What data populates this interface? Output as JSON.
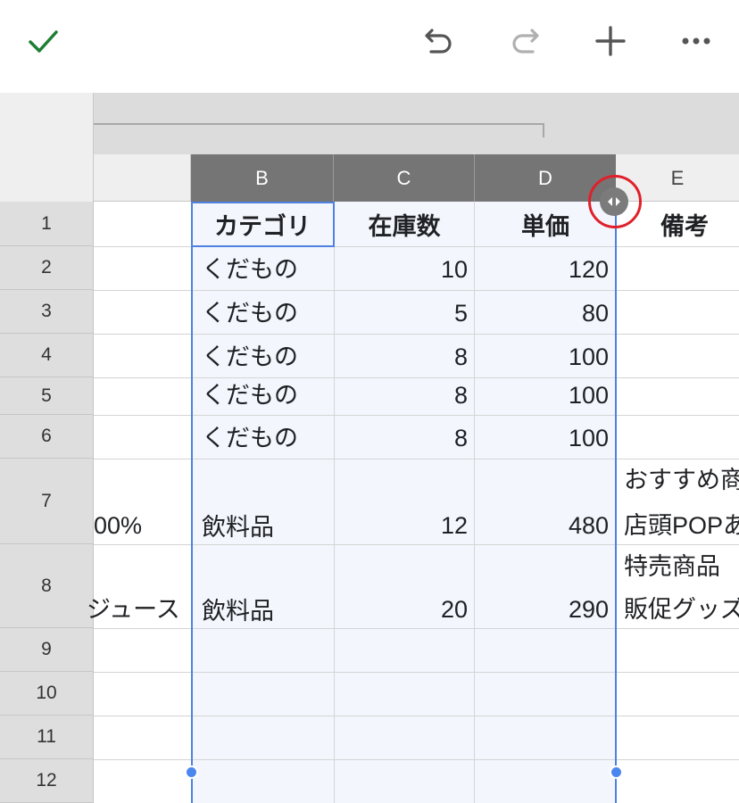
{
  "toolbar": {
    "done_icon": "check-icon",
    "undo_icon": "undo-icon",
    "redo_icon": "redo-icon",
    "add_icon": "plus-icon",
    "more_icon": "more-horizontal-icon",
    "done_color": "#1e7e34",
    "redo_disabled_color": "#b0b0b0"
  },
  "columns": {
    "B": "B",
    "C": "C",
    "D": "D",
    "E": "E"
  },
  "rows": [
    "1",
    "2",
    "3",
    "4",
    "5",
    "6",
    "7",
    "8",
    "9",
    "10",
    "11",
    "12"
  ],
  "cells": {
    "r1": {
      "B": "カテゴリ",
      "C": "在庫数",
      "D": "単価",
      "E": "備考"
    },
    "r2": {
      "B": "くだもの",
      "C": "10",
      "D": "120"
    },
    "r3": {
      "B": "くだもの",
      "C": "5",
      "D": "80"
    },
    "r4": {
      "B": "くだもの",
      "C": "8",
      "D": "100"
    },
    "r5": {
      "B": "くだもの",
      "C": "8",
      "D": "100"
    },
    "r6": {
      "B": "くだもの",
      "C": "8",
      "D": "100"
    },
    "r7": {
      "A": "00%",
      "B": "飲料品",
      "C": "12",
      "D": "480",
      "E1": "おすすめ商",
      "E2": "店頭POPあ"
    },
    "r8": {
      "A": "ジュース",
      "B": "飲料品",
      "C": "20",
      "D": "290",
      "E1": "特売商品",
      "E2": "販促グッズ"
    }
  },
  "colors": {
    "selection_border": "#4f81e0",
    "selected_header_bg": "#757575",
    "annotation_circle": "#e0202a"
  }
}
